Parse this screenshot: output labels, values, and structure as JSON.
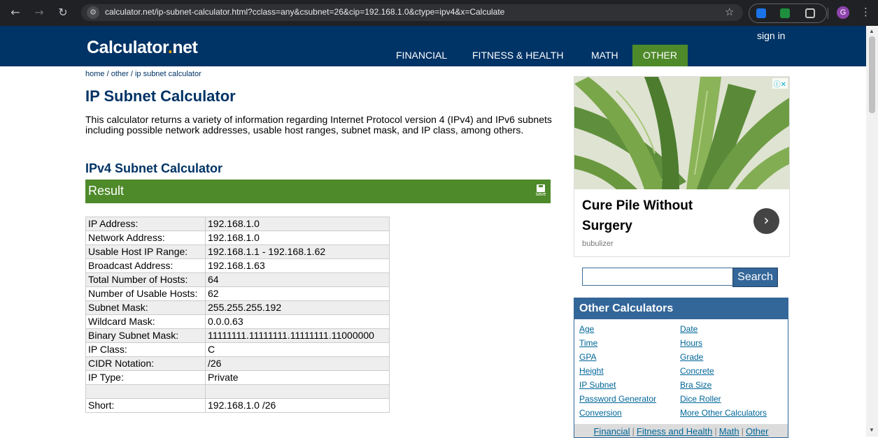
{
  "browser": {
    "url": "calculator.net/ip-subnet-calculator.html?cclass=any&csubnet=26&cip=192.168.1.0&ctype=ipv4&x=Calculate",
    "profile_initial": "G"
  },
  "header": {
    "logo_main": "Calculator",
    "logo_dot": ".",
    "logo_tld": "net",
    "sign_in": "sign in",
    "nav": [
      "FINANCIAL",
      "FITNESS & HEALTH",
      "MATH",
      "OTHER"
    ]
  },
  "breadcrumb": [
    "home",
    "other",
    "ip subnet calculator"
  ],
  "page_title": "IP Subnet Calculator",
  "intro": "This calculator returns a variety of information regarding Internet Protocol version 4 (IPv4) and IPv6 subnets including possible network addresses, usable host ranges, subnet mask, and IP class, among others.",
  "subtitle": "IPv4 Subnet Calculator",
  "result": {
    "label": "Result",
    "save_label": "save",
    "rows": [
      [
        "IP Address:",
        "192.168.1.0"
      ],
      [
        "Network Address:",
        "192.168.1.0"
      ],
      [
        "Usable Host IP Range:",
        "192.168.1.1 - 192.168.1.62"
      ],
      [
        "Broadcast Address:",
        "192.168.1.63"
      ],
      [
        "Total Number of Hosts:",
        "64"
      ],
      [
        "Number of Usable Hosts:",
        "62"
      ],
      [
        "Subnet Mask:",
        "255.255.255.192"
      ],
      [
        "Wildcard Mask:",
        "0.0.0.63"
      ],
      [
        "Binary Subnet Mask:",
        "11111111.11111111.11111111.11000000"
      ],
      [
        "IP Class:",
        "C"
      ],
      [
        "CIDR Notation:",
        "/26"
      ],
      [
        "IP Type:",
        "Private"
      ],
      [
        "",
        ""
      ],
      [
        "Short:",
        "192.168.1.0 /26"
      ]
    ]
  },
  "ad": {
    "title": "Cure Pile Without Surgery",
    "source": "bubulizer"
  },
  "search": {
    "placeholder": "",
    "button": "Search"
  },
  "other_calculators": {
    "title": "Other Calculators",
    "left": [
      "Age",
      "Time",
      "GPA",
      "Height",
      "IP Subnet",
      "Password Generator",
      "Conversion"
    ],
    "right": [
      "Date",
      "Hours",
      "Grade",
      "Concrete",
      "Bra Size",
      "Dice Roller",
      "More Other Calculators"
    ],
    "footer": [
      "Financial",
      "Fitness and Health",
      "Math",
      "Other"
    ]
  },
  "colors": {
    "header_bg": "#003366",
    "accent_green": "#4e8a2a",
    "link_blue": "#006699",
    "panel_blue": "#336699"
  }
}
